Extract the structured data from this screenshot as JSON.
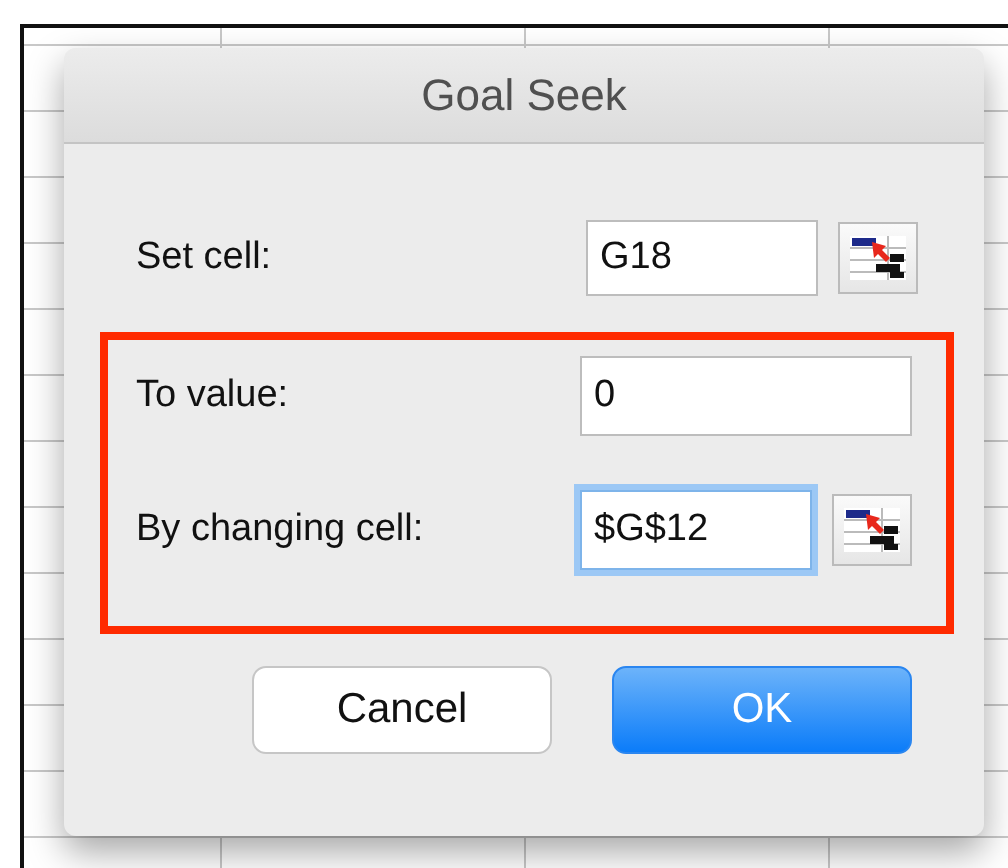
{
  "window": {
    "title": "Goal Seek"
  },
  "fields": [
    {
      "label": "Set cell:",
      "value": "G18",
      "picker": true,
      "focused": false,
      "highlighted": false
    },
    {
      "label": "To value:",
      "value": "0",
      "picker": false,
      "focused": false,
      "highlighted": true
    },
    {
      "label": "By changing cell:",
      "value": "$G$12",
      "picker": true,
      "focused": true,
      "highlighted": true
    }
  ],
  "buttons": [
    {
      "label": "Cancel",
      "default": false
    },
    {
      "label": "OK",
      "default": true
    }
  ]
}
